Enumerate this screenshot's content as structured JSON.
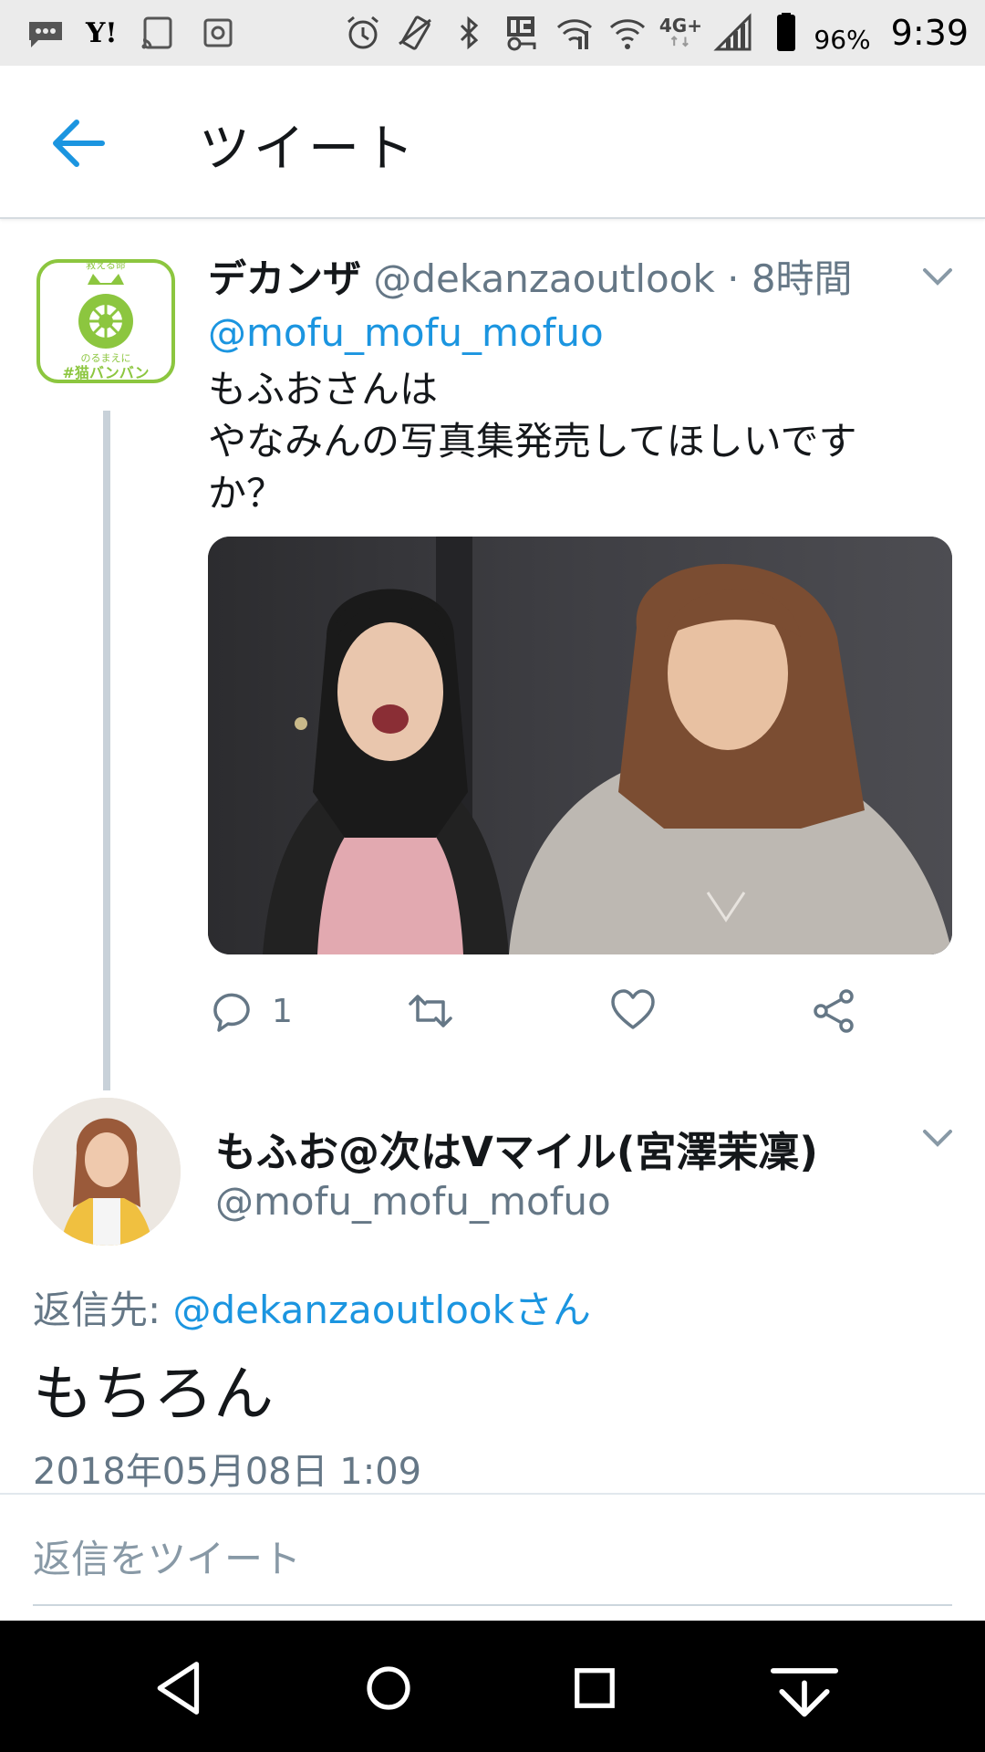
{
  "status_bar": {
    "carrier_icon": "Y!",
    "battery": "96%",
    "time": "9:39",
    "network": "4G+"
  },
  "header": {
    "title": "ツイート"
  },
  "tweet1": {
    "display_name": "デカンザ",
    "handle_time": "@dekanzaoutlook · 8時間",
    "mention": "@mofu_mofu_mofuo",
    "lines": [
      "もふおさんは",
      "やなみんの写真集発売してほしいです",
      "か？"
    ],
    "reply_count": "1",
    "avatar_text_top": "救える命",
    "avatar_text_mid": "のるまえに",
    "avatar_text_tag": "#猫バンバン"
  },
  "tweet2": {
    "display_name": "もふお@次はVマイル(宮澤茉凜)",
    "handle": "@mofu_mofu_mofuo",
    "reply_label": "返信先: ",
    "reply_target": "@dekanzaoutlookさん",
    "body": "もちろん",
    "date": "2018年05月08日 1:09"
  },
  "composer": {
    "placeholder": "返信をツイート"
  },
  "colors": {
    "accent": "#1b95e0",
    "secondary_text": "#657786",
    "thread_line": "#c8d1d9",
    "avatar_green": "#8cc63f"
  },
  "icons": {
    "back": "arrow-left-icon",
    "reply": "reply-bubble-icon",
    "retweet": "retweet-icon",
    "like": "heart-icon",
    "share": "share-icon",
    "more": "chevron-down-icon"
  }
}
